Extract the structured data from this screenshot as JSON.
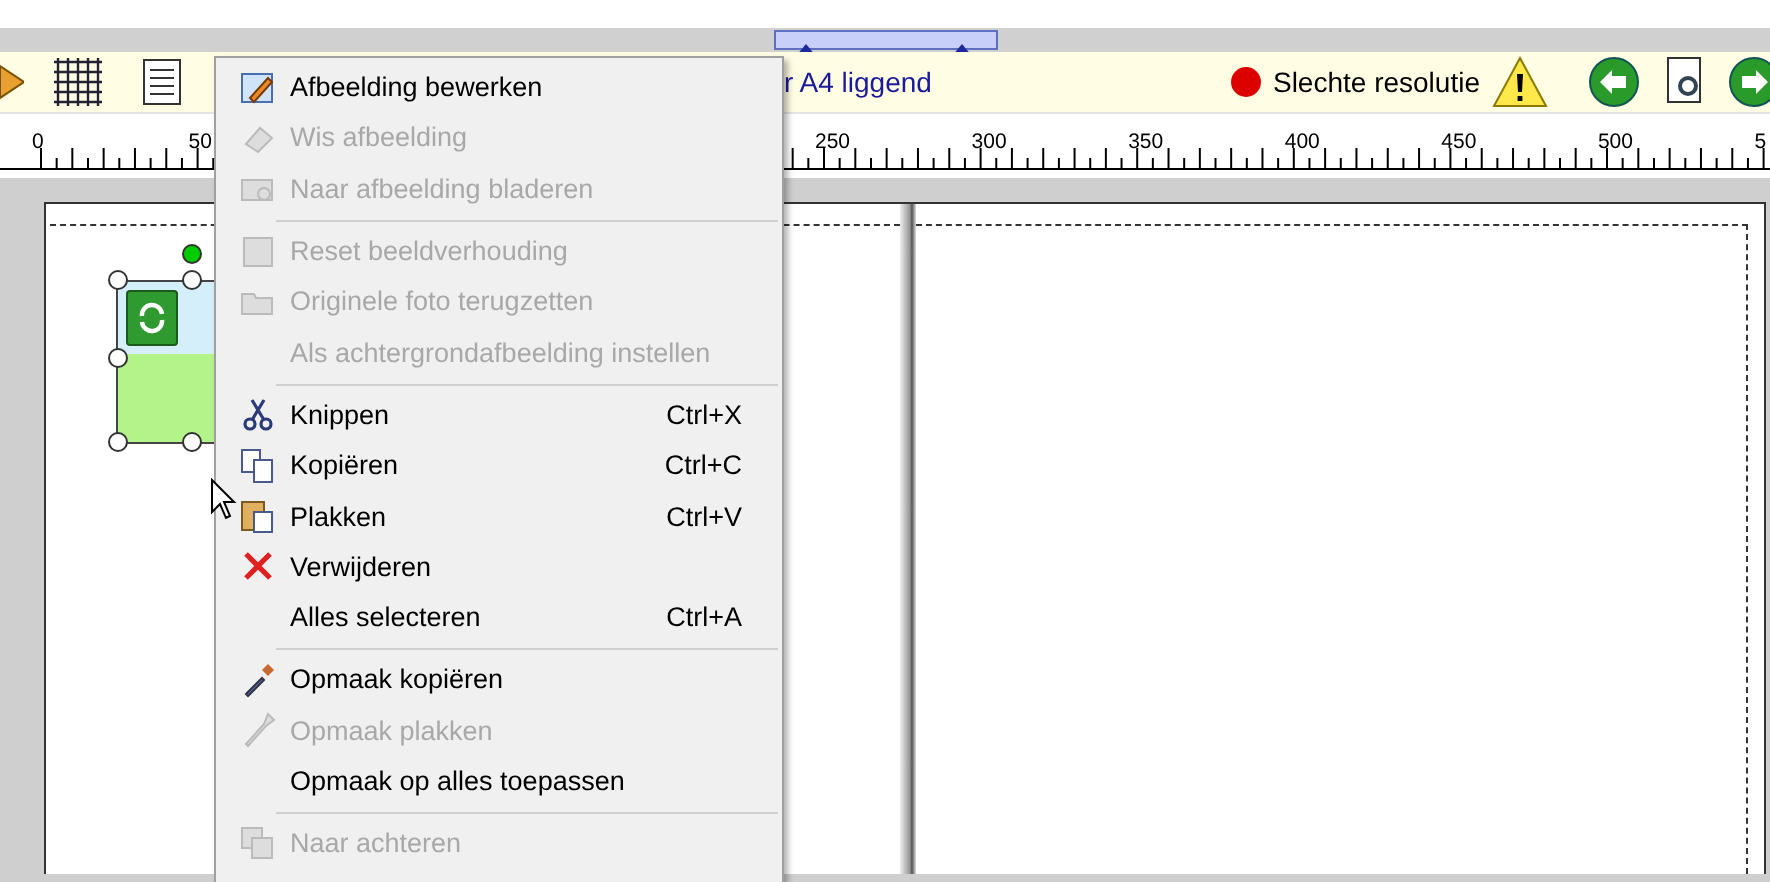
{
  "toolbar": {
    "layout_label": "r A4 liggend",
    "warning_label": "Slechte resolutie"
  },
  "ruler": {
    "left_labels": [
      "0",
      "50"
    ],
    "right_labels": [
      "250",
      "300",
      "350",
      "400",
      "450",
      "500",
      "5"
    ]
  },
  "context_menu": {
    "items": [
      {
        "kind": "item",
        "label": "Afbeelding bewerken",
        "disabled": false
      },
      {
        "kind": "item",
        "label": "Wis afbeelding",
        "disabled": true
      },
      {
        "kind": "item",
        "label": "Naar afbeelding bladeren",
        "disabled": true
      },
      {
        "kind": "separator"
      },
      {
        "kind": "item",
        "label": "Reset beeldverhouding",
        "disabled": true
      },
      {
        "kind": "item",
        "label": "Originele foto terugzetten",
        "disabled": true
      },
      {
        "kind": "item",
        "label": "Als achtergrondafbeelding instellen",
        "disabled": true
      },
      {
        "kind": "separator"
      },
      {
        "kind": "item",
        "label": "Knippen",
        "shortcut": "Ctrl+X",
        "disabled": false
      },
      {
        "kind": "item",
        "label": "Kopiëren",
        "shortcut": "Ctrl+C",
        "disabled": false
      },
      {
        "kind": "item",
        "label": "Plakken",
        "shortcut": "Ctrl+V",
        "disabled": false
      },
      {
        "kind": "item",
        "label": "Verwijderen",
        "disabled": false
      },
      {
        "kind": "item",
        "label": "Alles selecteren",
        "shortcut": "Ctrl+A",
        "disabled": false
      },
      {
        "kind": "separator"
      },
      {
        "kind": "item",
        "label": "Opmaak kopiëren",
        "disabled": false
      },
      {
        "kind": "item",
        "label": "Opmaak plakken",
        "disabled": true
      },
      {
        "kind": "item",
        "label": "Opmaak op alles toepassen",
        "disabled": false
      },
      {
        "kind": "separator"
      },
      {
        "kind": "item",
        "label": "Naar achteren",
        "disabled": true
      }
    ]
  }
}
